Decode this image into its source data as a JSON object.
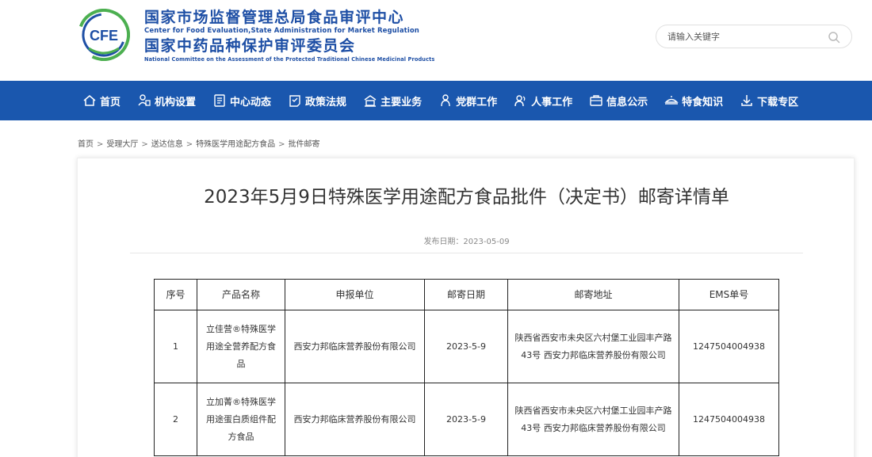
{
  "header": {
    "logo_text": "CFE",
    "org_name_cn": "国家市场监督管理总局食品审评中心",
    "org_name_en": "Center for Food Evaluation,State Administration for Market Regulation",
    "committee_cn": "国家中药品种保护审评委员会",
    "committee_en": "National Committee on the Assessment of the Protected Traditional Chinese Medicinal Products",
    "brand_colors": {
      "blue": "#1e4fa5",
      "green": "#4caf50"
    }
  },
  "search": {
    "placeholder": "请输入关键字",
    "icon": "search-icon"
  },
  "nav": {
    "background": "#1a57ae",
    "items": [
      {
        "label": "首页",
        "icon": "home-icon"
      },
      {
        "label": "机构设置",
        "icon": "org-chart-icon"
      },
      {
        "label": "中心动态",
        "icon": "news-icon"
      },
      {
        "label": "政策法规",
        "icon": "policy-icon"
      },
      {
        "label": "主要业务",
        "icon": "business-icon"
      },
      {
        "label": "党群工作",
        "icon": "party-icon"
      },
      {
        "label": "人事工作",
        "icon": "personnel-icon"
      },
      {
        "label": "信息公示",
        "icon": "bulletin-icon"
      },
      {
        "label": "特食知识",
        "icon": "knowledge-icon"
      },
      {
        "label": "下载专区",
        "icon": "download-icon"
      }
    ]
  },
  "breadcrumb": {
    "separator": ">",
    "items": [
      "首页",
      "受理大厅",
      "送达信息",
      "特殊医学用途配方食品",
      "批件邮寄"
    ]
  },
  "article": {
    "title": "2023年5月9日特殊医学用途配方食品批件（决定书）邮寄详情单",
    "publish_date": "发布日期：2023-05-09"
  },
  "table": {
    "headers": [
      "序号",
      "产品名称",
      "申报单位",
      "邮寄日期",
      "邮寄地址",
      "EMS单号"
    ],
    "rows": [
      [
        "1",
        "立佳营®特殊医学用途全营养配方食品",
        "西安力邦临床营养股份有限公司",
        "2023-5-9",
        "陕西省西安市未央区六村堡工业园丰产路43号 西安力邦临床营养股份有限公司",
        "1247504004938"
      ],
      [
        "2",
        "立加菁®特殊医学用途蛋白质组件配方食品",
        "西安力邦临床营养股份有限公司",
        "2023-5-9",
        "陕西省西安市未央区六村堡工业园丰产路43号 西安力邦临床营养股份有限公司",
        "1247504004938"
      ]
    ]
  }
}
